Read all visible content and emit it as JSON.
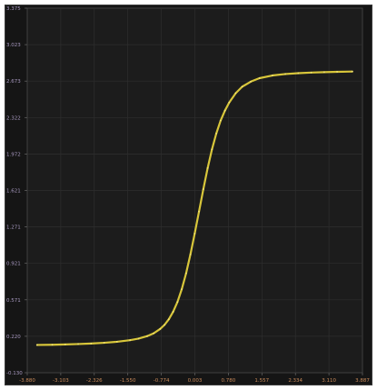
{
  "chart_data": {
    "type": "line",
    "title": "",
    "xlabel": "",
    "ylabel": "",
    "xlim": [
      -3.88,
      3.887
    ],
    "ylim": [
      -0.13,
      3.375
    ],
    "x_ticks": [
      "-3.880",
      "-3.103",
      "-2.326",
      "-1.550",
      "-0.774",
      "0.003",
      "0.780",
      "1.557",
      "2.334",
      "3.110",
      "3.887"
    ],
    "y_ticks": [
      "-0.130",
      "0.220",
      "0.571",
      "0.921",
      "1.271",
      "1.621",
      "1.972",
      "2.322",
      "2.673",
      "3.023",
      "3.375"
    ],
    "grid": true,
    "series": [
      {
        "color": "#d8c63a",
        "x": [
          -3.65,
          -3.3,
          -3.0,
          -2.7,
          -2.4,
          -2.1,
          -1.8,
          -1.5,
          -1.3,
          -1.1,
          -0.95,
          -0.8,
          -0.7,
          -0.6,
          -0.5,
          -0.4,
          -0.3,
          -0.2,
          -0.1,
          0.0,
          0.1,
          0.2,
          0.3,
          0.4,
          0.5,
          0.6,
          0.7,
          0.8,
          0.95,
          1.1,
          1.3,
          1.5,
          1.8,
          2.1,
          2.4,
          2.7,
          3.0,
          3.3,
          3.65
        ],
        "y": [
          0.137,
          0.139,
          0.142,
          0.146,
          0.151,
          0.158,
          0.168,
          0.183,
          0.198,
          0.222,
          0.249,
          0.291,
          0.33,
          0.384,
          0.456,
          0.55,
          0.673,
          0.825,
          1.006,
          1.208,
          1.42,
          1.635,
          1.838,
          2.018,
          2.17,
          2.294,
          2.39,
          2.468,
          2.558,
          2.62,
          2.669,
          2.702,
          2.728,
          2.742,
          2.75,
          2.756,
          2.76,
          2.763,
          2.766
        ]
      }
    ]
  }
}
